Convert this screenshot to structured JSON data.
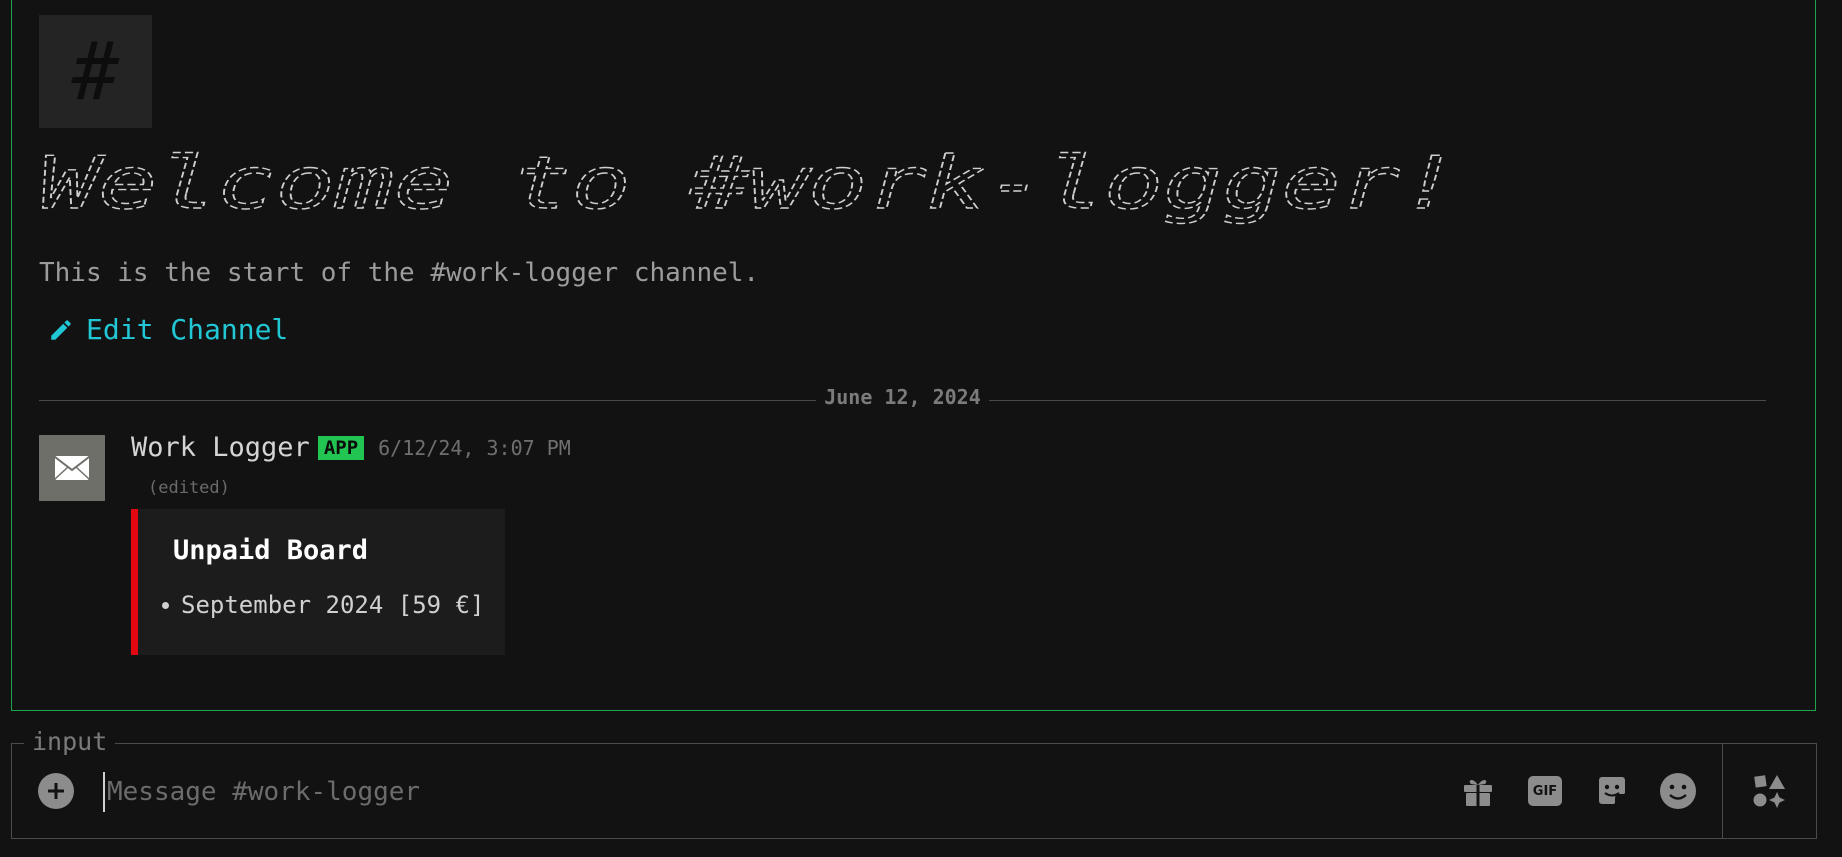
{
  "channel": {
    "hash_symbol": "#",
    "welcome_title": "Welcome to #work-logger!",
    "start_text": "This is the start of the #work-logger channel.",
    "edit_label": "Edit Channel"
  },
  "divider": {
    "date": "June 12, 2024"
  },
  "message": {
    "author": "Work Logger",
    "badge": "APP",
    "timestamp": "6/12/24, 3:07 PM",
    "edited": "(edited)",
    "embed": {
      "title": "Unpaid Board",
      "items": [
        "September 2024 [59 €]"
      ],
      "accent_color": "#e3080f"
    },
    "avatar_icon": "envelope-icon"
  },
  "input": {
    "legend": "input",
    "placeholder": "Message #work-logger",
    "icons": [
      "plus-icon",
      "gift-icon",
      "gif-icon",
      "sticker-icon",
      "emoji-icon",
      "apps-icon"
    ],
    "gif_label": "GIF"
  },
  "colors": {
    "frame_border": "#1fa34a",
    "link": "#22c7d6",
    "badge_bg": "#23c552",
    "background": "#121212"
  }
}
